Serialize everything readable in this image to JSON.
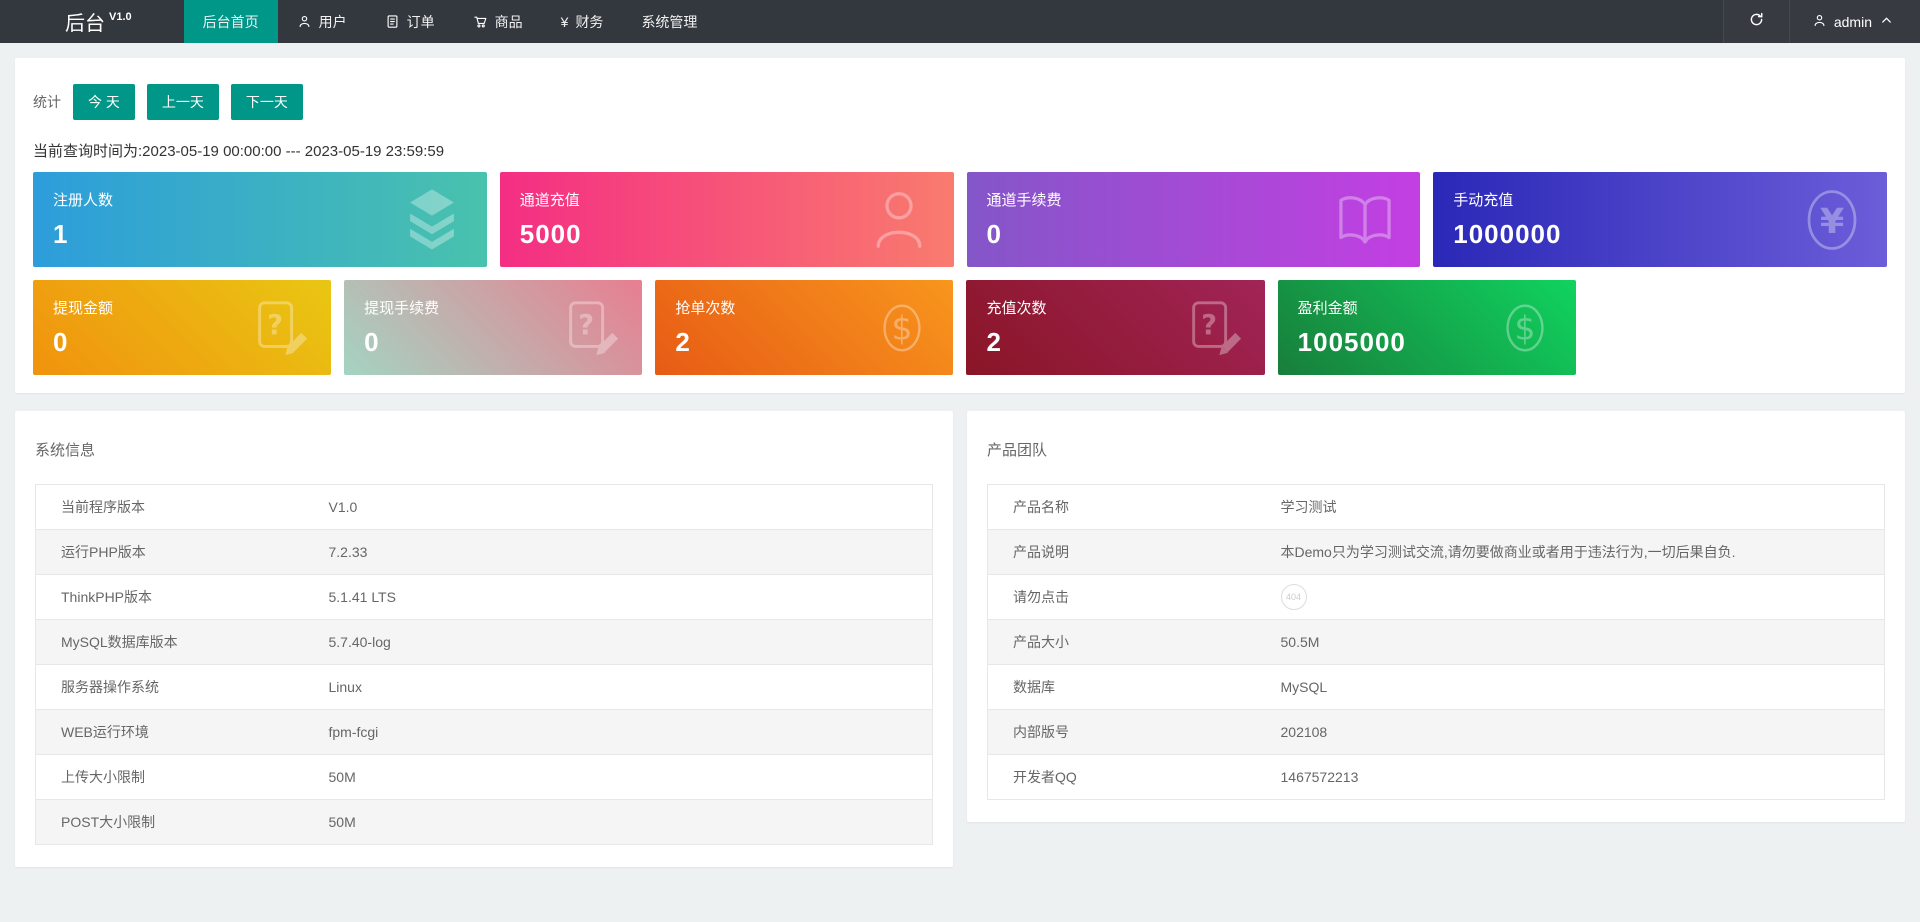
{
  "colors": {
    "accent": "#009688",
    "navbar_bg": "#33373e",
    "page_bg": "#eef1f2"
  },
  "navbar": {
    "brand": "后台",
    "version": "V1.0",
    "menu": [
      {
        "name": "home",
        "label": "后台首页",
        "icon": "",
        "active": true
      },
      {
        "name": "users",
        "label": "用户",
        "icon": "user",
        "active": false
      },
      {
        "name": "orders",
        "label": "订单",
        "icon": "file",
        "active": false
      },
      {
        "name": "goods",
        "label": "商品",
        "icon": "cart",
        "active": false
      },
      {
        "name": "finance",
        "label": "财务",
        "icon": "yen",
        "active": false
      },
      {
        "name": "system",
        "label": "系统管理",
        "icon": "",
        "active": false
      }
    ],
    "username": "admin"
  },
  "stats": {
    "label": "统计",
    "range_buttons": [
      {
        "name": "today",
        "label": "今 天"
      },
      {
        "name": "prev-day",
        "label": "上一天"
      },
      {
        "name": "next-day",
        "label": "下一天"
      }
    ],
    "query_time": "当前查询时间为:2023-05-19 00:00:00 --- 2023-05-19 23:59:59",
    "cards_row1": [
      {
        "title": "注册人数",
        "value": "1",
        "icon": "layers-icon",
        "from": "#2d9ddb",
        "to": "#49c2ad",
        "dir": "90deg"
      },
      {
        "title": "通道充值",
        "value": "5000",
        "icon": "person-icon",
        "from": "#f42e83",
        "to": "#f97b6e",
        "dir": "90deg"
      },
      {
        "title": "通道手续费",
        "value": "0",
        "icon": "book-icon",
        "from": "#8456c8",
        "to": "#c33fe2",
        "dir": "90deg"
      },
      {
        "title": "手动充值",
        "value": "1000000",
        "icon": "yuan-circle-icon",
        "from": "#2a28b7",
        "to": "#6c5dd9",
        "dir": "90deg"
      }
    ],
    "cards_row2": [
      {
        "title": "提现金额",
        "value": "0",
        "icon": "doc-question-icon",
        "from": "#f1920e",
        "to": "#e9c713",
        "dir": "45deg"
      },
      {
        "title": "提现手续费",
        "value": "0",
        "icon": "doc-question-icon",
        "from": "#a4d4c2",
        "to": "#e87e90",
        "dir": "45deg"
      },
      {
        "title": "抢单次数",
        "value": "2",
        "icon": "dollar-circle-icon",
        "from": "#e75b15",
        "to": "#f8961d",
        "dir": "45deg"
      },
      {
        "title": "充值次数",
        "value": "2",
        "icon": "doc-question-icon",
        "from": "#8a1526",
        "to": "#a12457",
        "dir": "45deg"
      },
      {
        "title": "盈利金额",
        "value": "1005000",
        "icon": "dollar-circle-icon",
        "from": "#187e3b",
        "to": "#10d35f",
        "dir": "45deg"
      }
    ]
  },
  "system_info": {
    "title": "系统信息",
    "rows": [
      {
        "label": "当前程序版本",
        "value": "V1.0"
      },
      {
        "label": "运行PHP版本",
        "value": "7.2.33"
      },
      {
        "label": "ThinkPHP版本",
        "value": "5.1.41 LTS"
      },
      {
        "label": "MySQL数据库版本",
        "value": "5.7.40-log"
      },
      {
        "label": "服务器操作系统",
        "value": "Linux"
      },
      {
        "label": "WEB运行环境",
        "value": "fpm-fcgi"
      },
      {
        "label": "上传大小限制",
        "value": "50M"
      },
      {
        "label": "POST大小限制",
        "value": "50M"
      }
    ]
  },
  "product_team": {
    "title": "产品团队",
    "rows": [
      {
        "label": "产品名称",
        "value": "学习测试"
      },
      {
        "label": "产品说明",
        "value": "本Demo只为学习测试交流,请勿要做商业或者用于违法行为,一切后果自负."
      },
      {
        "label": "请勿点击",
        "value": "",
        "badge": "404"
      },
      {
        "label": "产品大小",
        "value": "50.5M"
      },
      {
        "label": "数据库",
        "value": "MySQL"
      },
      {
        "label": "内部版号",
        "value": "202108"
      },
      {
        "label": "开发者QQ",
        "value": "1467572213"
      }
    ]
  }
}
